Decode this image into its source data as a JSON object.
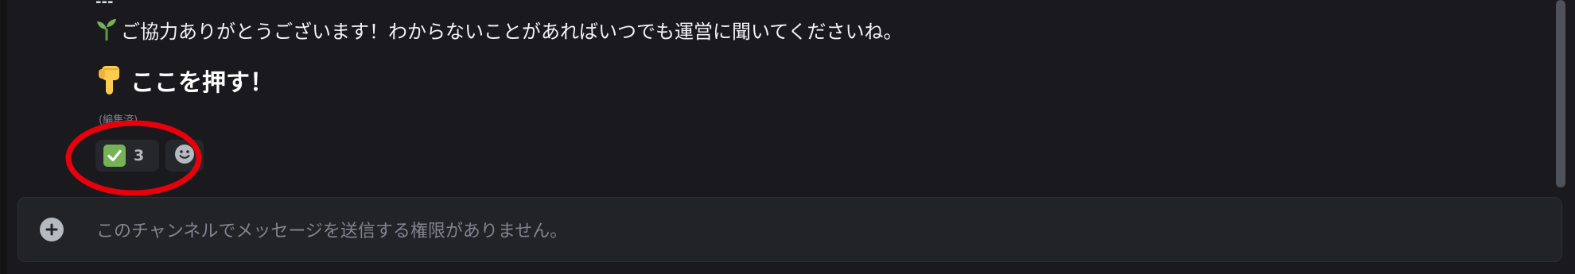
{
  "message": {
    "separator": "---",
    "line1": {
      "icon": "seedling-icon",
      "text": "ご協力ありがとうございます！わからないことがあればいつでも運営に聞いてくださいね。"
    },
    "line2": {
      "icon": "pointing-down-icon",
      "text": "ここを押す！"
    },
    "edited_label": "(編集済)"
  },
  "reactions": [
    {
      "icon": "white-check-mark-icon",
      "count": "3"
    }
  ],
  "add_reaction": {
    "icon": "add-reaction-icon"
  },
  "annotation": {
    "shape": "circle",
    "color": "#e8000b"
  },
  "composer": {
    "icon": "plus-circle-icon",
    "placeholder": "このチャンネルでメッセージを送信する権限がありません。"
  },
  "colors": {
    "background": "#1a1a1e",
    "composer_bg": "#222327",
    "reaction_bg": "#26272c",
    "check_green": "#77b255",
    "muted_text": "#80848e"
  }
}
